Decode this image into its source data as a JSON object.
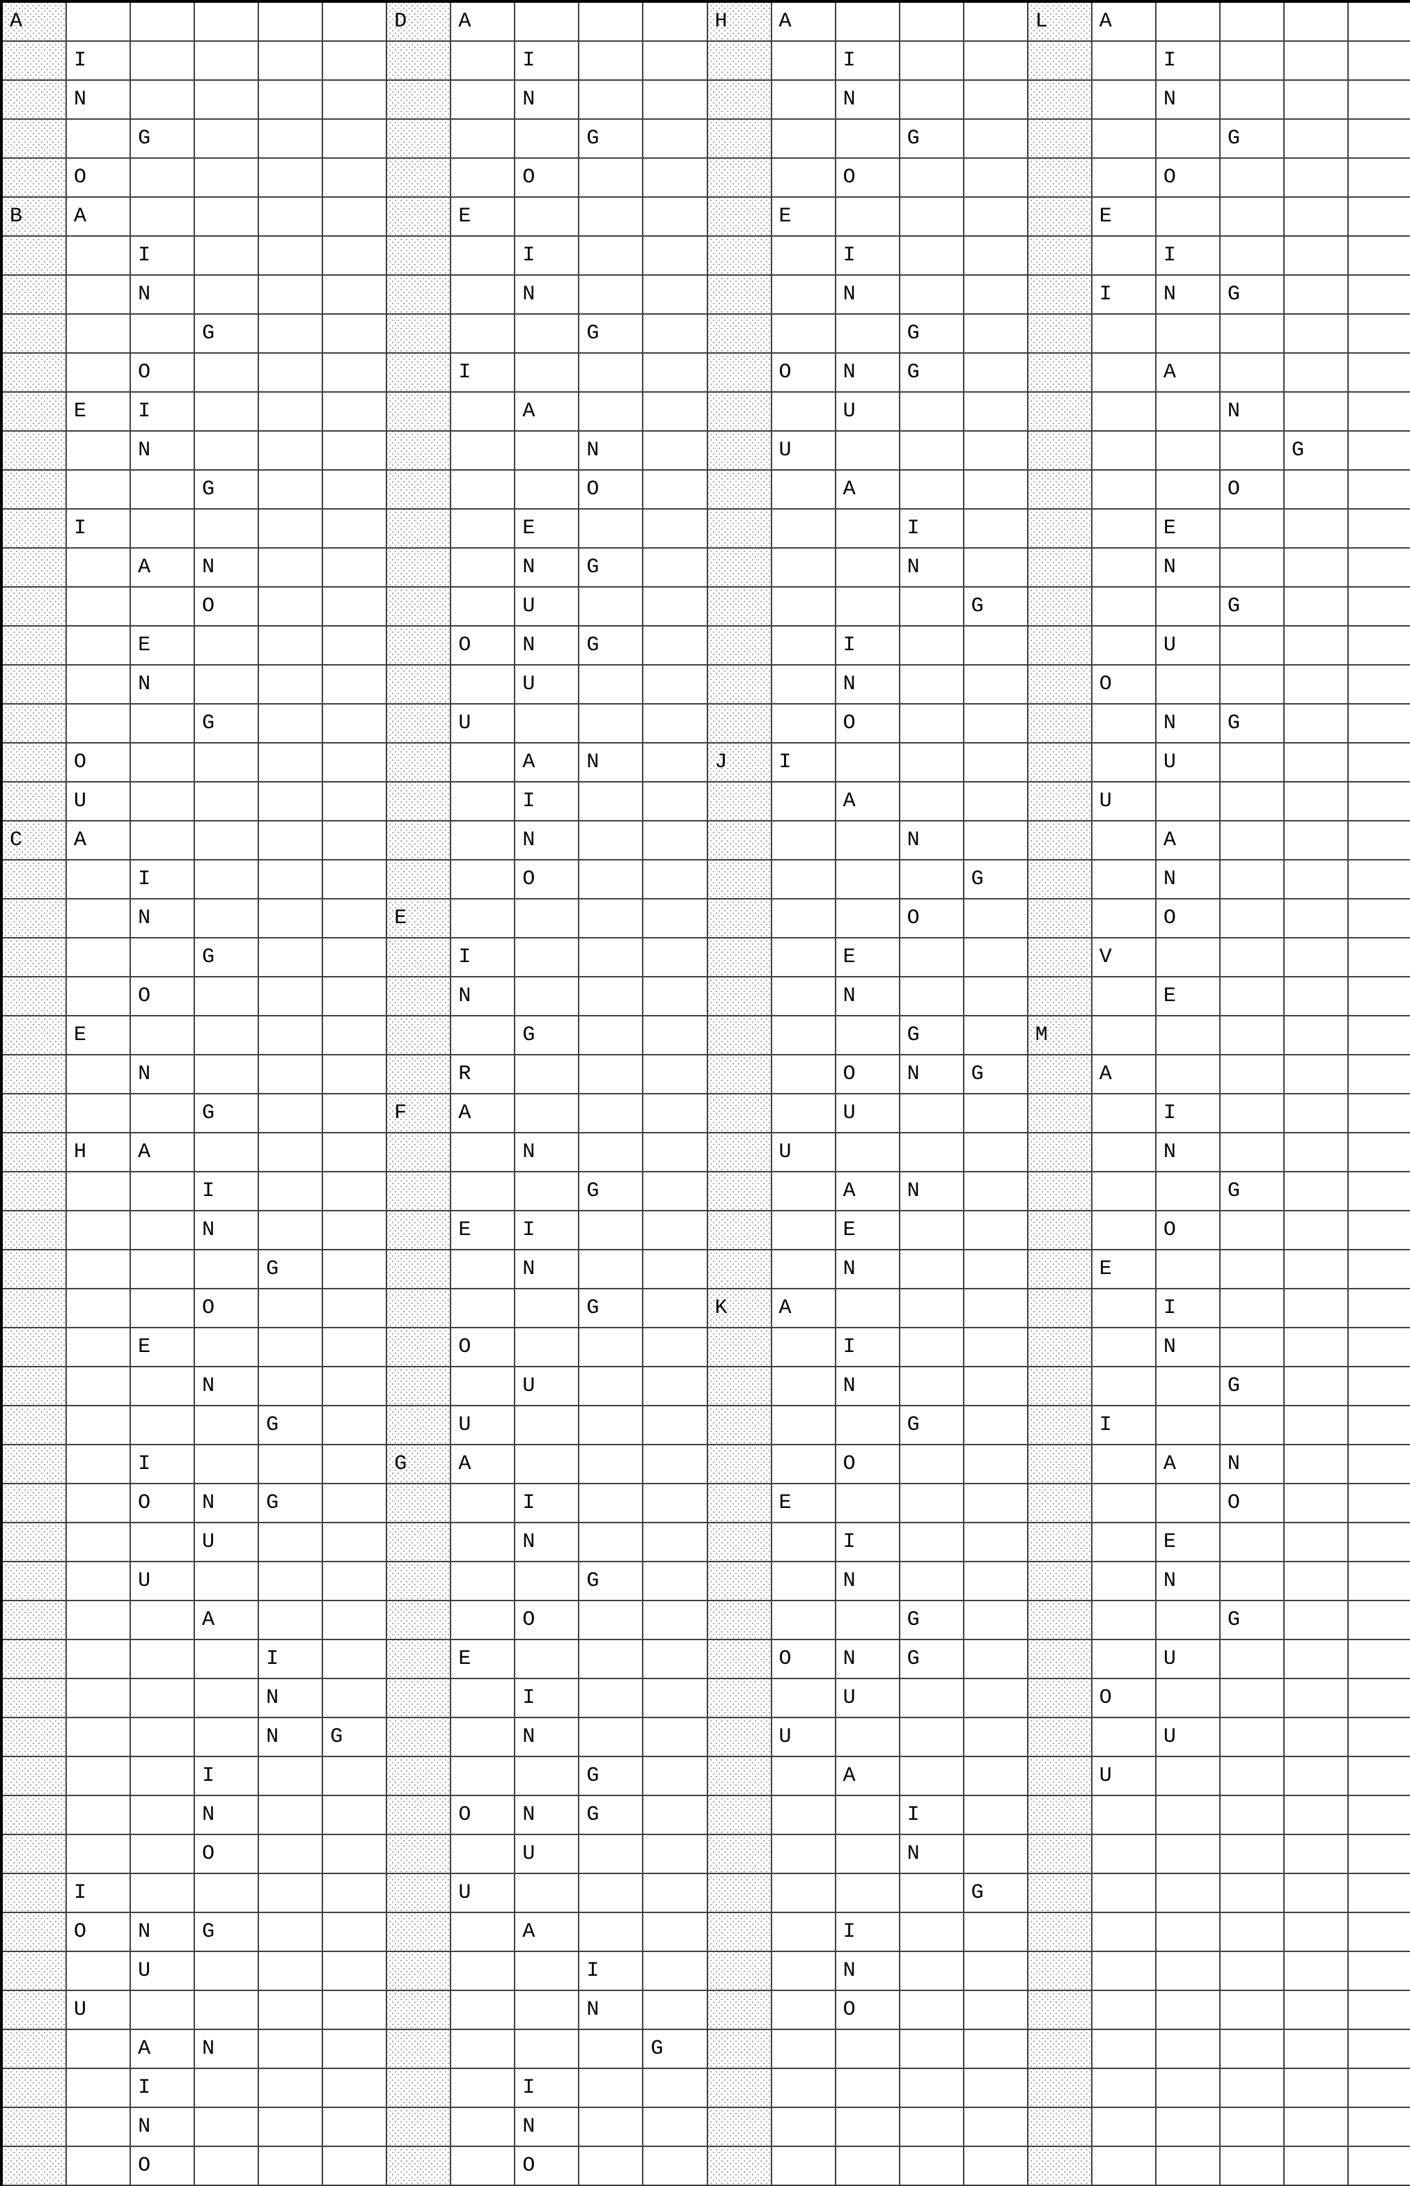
{
  "grid": {
    "cols": 22,
    "rows": 46,
    "cells": [
      {
        "r": 0,
        "c": 0,
        "v": "A"
      },
      {
        "r": 0,
        "c": 6,
        "v": "D"
      },
      {
        "r": 0,
        "c": 7,
        "v": "A"
      },
      {
        "r": 0,
        "c": 11,
        "v": "H"
      },
      {
        "r": 0,
        "c": 12,
        "v": "A"
      },
      {
        "r": 0,
        "c": 16,
        "v": "L"
      },
      {
        "r": 0,
        "c": 17,
        "v": "A"
      },
      {
        "r": 1,
        "c": 1,
        "v": "I"
      },
      {
        "r": 1,
        "c": 8,
        "v": "I"
      },
      {
        "r": 1,
        "c": 13,
        "v": "I"
      },
      {
        "r": 1,
        "c": 18,
        "v": "I"
      },
      {
        "r": 2,
        "c": 1,
        "v": "N"
      },
      {
        "r": 2,
        "c": 8,
        "v": "N"
      },
      {
        "r": 2,
        "c": 13,
        "v": "N"
      },
      {
        "r": 2,
        "c": 18,
        "v": "N"
      },
      {
        "r": 3,
        "c": 2,
        "v": "G"
      },
      {
        "r": 3,
        "c": 9,
        "v": "G"
      },
      {
        "r": 3,
        "c": 14,
        "v": "G"
      },
      {
        "r": 3,
        "c": 19,
        "v": "G"
      },
      {
        "r": 4,
        "c": 1,
        "v": "O"
      },
      {
        "r": 4,
        "c": 8,
        "v": "O"
      },
      {
        "r": 4,
        "c": 13,
        "v": "O"
      },
      {
        "r": 4,
        "c": 18,
        "v": "O"
      },
      {
        "r": 5,
        "c": 0,
        "v": "B"
      },
      {
        "r": 5,
        "c": 1,
        "v": "A"
      },
      {
        "r": 5,
        "c": 7,
        "v": "E"
      },
      {
        "r": 5,
        "c": 12,
        "v": "E"
      },
      {
        "r": 5,
        "c": 17,
        "v": "E"
      },
      {
        "r": 6,
        "c": 2,
        "v": "I"
      },
      {
        "r": 6,
        "c": 8,
        "v": "I"
      },
      {
        "r": 6,
        "c": 13,
        "v": "I"
      },
      {
        "r": 6,
        "c": 18,
        "v": "I"
      },
      {
        "r": 7,
        "c": 2,
        "v": "N"
      },
      {
        "r": 7,
        "c": 8,
        "v": "N"
      },
      {
        "r": 7,
        "c": 13,
        "v": "N"
      },
      {
        "r": 7,
        "c": 17,
        "v": "I"
      },
      {
        "r": 7,
        "c": 18,
        "v": "N"
      },
      {
        "r": 7,
        "c": 19,
        "v": "G"
      },
      {
        "r": 8,
        "c": 3,
        "v": "G"
      },
      {
        "r": 8,
        "c": 9,
        "v": "G"
      },
      {
        "r": 8,
        "c": 14,
        "v": "G"
      },
      {
        "r": 9,
        "c": 2,
        "v": "O"
      },
      {
        "r": 9,
        "c": 7,
        "v": "I"
      },
      {
        "r": 9,
        "c": 12,
        "v": "O"
      },
      {
        "r": 9,
        "c": 13,
        "v": "N"
      },
      {
        "r": 9,
        "c": 14,
        "v": "G"
      },
      {
        "r": 9,
        "c": 18,
        "v": "A"
      },
      {
        "r": 10,
        "c": 1,
        "v": "E"
      },
      {
        "r": 10,
        "c": 2,
        "v": "I"
      },
      {
        "r": 10,
        "c": 8,
        "v": "A"
      },
      {
        "r": 10,
        "c": 13,
        "v": "U"
      },
      {
        "r": 10,
        "c": 19,
        "v": "N"
      },
      {
        "r": 11,
        "c": 2,
        "v": "N"
      },
      {
        "r": 11,
        "c": 9,
        "v": "N"
      },
      {
        "r": 11,
        "c": 12,
        "v": "U"
      },
      {
        "r": 11,
        "c": 20,
        "v": "G"
      },
      {
        "r": 12,
        "c": 3,
        "v": "G"
      },
      {
        "r": 12,
        "c": 9,
        "v": "O"
      },
      {
        "r": 12,
        "c": 13,
        "v": "A"
      },
      {
        "r": 12,
        "c": 19,
        "v": "O"
      },
      {
        "r": 13,
        "c": 1,
        "v": "I"
      },
      {
        "r": 13,
        "c": 8,
        "v": "E"
      },
      {
        "r": 13,
        "c": 14,
        "v": "I"
      },
      {
        "r": 13,
        "c": 18,
        "v": "E"
      },
      {
        "r": 14,
        "c": 2,
        "v": "A"
      },
      {
        "r": 14,
        "c": 3,
        "v": "N"
      },
      {
        "r": 14,
        "c": 8,
        "v": "N"
      },
      {
        "r": 14,
        "c": 9,
        "v": "G"
      },
      {
        "r": 14,
        "c": 14,
        "v": "N"
      },
      {
        "r": 14,
        "c": 18,
        "v": "N"
      },
      {
        "r": 15,
        "c": 3,
        "v": "O"
      },
      {
        "r": 15,
        "c": 8,
        "v": "U"
      },
      {
        "r": 15,
        "c": 15,
        "v": "G"
      },
      {
        "r": 15,
        "c": 19,
        "v": "G"
      },
      {
        "r": 16,
        "c": 2,
        "v": "E"
      },
      {
        "r": 16,
        "c": 7,
        "v": "O"
      },
      {
        "r": 16,
        "c": 8,
        "v": "N"
      },
      {
        "r": 16,
        "c": 9,
        "v": "G"
      },
      {
        "r": 16,
        "c": 13,
        "v": "I"
      },
      {
        "r": 16,
        "c": 18,
        "v": "U"
      },
      {
        "r": 17,
        "c": 2,
        "v": "N"
      },
      {
        "r": 17,
        "c": 8,
        "v": "U"
      },
      {
        "r": 17,
        "c": 13,
        "v": "N"
      },
      {
        "r": 17,
        "c": 17,
        "v": "O"
      },
      {
        "r": 18,
        "c": 3,
        "v": "G"
      },
      {
        "r": 18,
        "c": 7,
        "v": "U"
      },
      {
        "r": 18,
        "c": 13,
        "v": "O"
      },
      {
        "r": 18,
        "c": 18,
        "v": "N"
      },
      {
        "r": 18,
        "c": 19,
        "v": "G"
      },
      {
        "r": 19,
        "c": 1,
        "v": "O"
      },
      {
        "r": 19,
        "c": 8,
        "v": "A"
      },
      {
        "r": 19,
        "c": 9,
        "v": "N"
      },
      {
        "r": 19,
        "c": 11,
        "v": "J"
      },
      {
        "r": 19,
        "c": 12,
        "v": "I"
      },
      {
        "r": 19,
        "c": 18,
        "v": "U"
      },
      {
        "r": 20,
        "c": 1,
        "v": "U"
      },
      {
        "r": 20,
        "c": 8,
        "v": "I"
      },
      {
        "r": 20,
        "c": 13,
        "v": "A"
      },
      {
        "r": 20,
        "c": 17,
        "v": "U"
      },
      {
        "r": 21,
        "c": 0,
        "v": "C"
      },
      {
        "r": 21,
        "c": 1,
        "v": "A"
      },
      {
        "r": 21,
        "c": 8,
        "v": "N"
      },
      {
        "r": 21,
        "c": 14,
        "v": "N"
      },
      {
        "r": 21,
        "c": 18,
        "v": "A"
      },
      {
        "r": 22,
        "c": 2,
        "v": "I"
      },
      {
        "r": 22,
        "c": 8,
        "v": "O"
      },
      {
        "r": 22,
        "c": 15,
        "v": "G"
      },
      {
        "r": 22,
        "c": 18,
        "v": "N"
      },
      {
        "r": 23,
        "c": 2,
        "v": "N"
      },
      {
        "r": 23,
        "c": 6,
        "v": "E"
      },
      {
        "r": 23,
        "c": 14,
        "v": "O"
      },
      {
        "r": 23,
        "c": 18,
        "v": "O"
      },
      {
        "r": 24,
        "c": 3,
        "v": "G"
      },
      {
        "r": 24,
        "c": 7,
        "v": "I"
      },
      {
        "r": 24,
        "c": 13,
        "v": "E"
      },
      {
        "r": 24,
        "c": 17,
        "v": "V"
      },
      {
        "r": 25,
        "c": 2,
        "v": "O"
      },
      {
        "r": 25,
        "c": 7,
        "v": "N"
      },
      {
        "r": 25,
        "c": 13,
        "v": "N"
      },
      {
        "r": 25,
        "c": 18,
        "v": "E"
      },
      {
        "r": 26,
        "c": 1,
        "v": "E"
      },
      {
        "r": 26,
        "c": 8,
        "v": "G"
      },
      {
        "r": 26,
        "c": 14,
        "v": "G"
      },
      {
        "r": 26,
        "c": 16,
        "v": "M"
      },
      {
        "r": 27,
        "c": 2,
        "v": "N"
      },
      {
        "r": 27,
        "c": 7,
        "v": "R"
      },
      {
        "r": 27,
        "c": 13,
        "v": "O"
      },
      {
        "r": 27,
        "c": 14,
        "v": "N"
      },
      {
        "r": 27,
        "c": 15,
        "v": "G"
      },
      {
        "r": 27,
        "c": 17,
        "v": "A"
      },
      {
        "r": 28,
        "c": 3,
        "v": "G"
      },
      {
        "r": 28,
        "c": 6,
        "v": "F"
      },
      {
        "r": 28,
        "c": 7,
        "v": "A"
      },
      {
        "r": 28,
        "c": 13,
        "v": "U"
      },
      {
        "r": 28,
        "c": 18,
        "v": "I"
      },
      {
        "r": 29,
        "c": 1,
        "v": "H"
      },
      {
        "r": 29,
        "c": 2,
        "v": "A"
      },
      {
        "r": 29,
        "c": 8,
        "v": "N"
      },
      {
        "r": 29,
        "c": 12,
        "v": "U"
      },
      {
        "r": 29,
        "c": 18,
        "v": "N"
      },
      {
        "r": 30,
        "c": 3,
        "v": "I"
      },
      {
        "r": 30,
        "c": 9,
        "v": "G"
      },
      {
        "r": 30,
        "c": 13,
        "v": "A"
      },
      {
        "r": 30,
        "c": 14,
        "v": "N"
      },
      {
        "r": 30,
        "c": 19,
        "v": "G"
      },
      {
        "r": 31,
        "c": 3,
        "v": "N"
      },
      {
        "r": 31,
        "c": 7,
        "v": "E"
      },
      {
        "r": 31,
        "c": 8,
        "v": "I"
      },
      {
        "r": 31,
        "c": 13,
        "v": "E"
      },
      {
        "r": 31,
        "c": 18,
        "v": "O"
      },
      {
        "r": 32,
        "c": 4,
        "v": "G"
      },
      {
        "r": 32,
        "c": 8,
        "v": "N"
      },
      {
        "r": 32,
        "c": 13,
        "v": "N"
      },
      {
        "r": 32,
        "c": 17,
        "v": "E"
      },
      {
        "r": 33,
        "c": 3,
        "v": "O"
      },
      {
        "r": 33,
        "c": 9,
        "v": "G"
      },
      {
        "r": 33,
        "c": 11,
        "v": "K"
      },
      {
        "r": 33,
        "c": 12,
        "v": "A"
      },
      {
        "r": 33,
        "c": 18,
        "v": "I"
      },
      {
        "r": 34,
        "c": 2,
        "v": "E"
      },
      {
        "r": 34,
        "c": 7,
        "v": "O"
      },
      {
        "r": 34,
        "c": 13,
        "v": "I"
      },
      {
        "r": 34,
        "c": 18,
        "v": "N"
      },
      {
        "r": 35,
        "c": 3,
        "v": "N"
      },
      {
        "r": 35,
        "c": 8,
        "v": "U"
      },
      {
        "r": 35,
        "c": 13,
        "v": "N"
      },
      {
        "r": 35,
        "c": 19,
        "v": "G"
      },
      {
        "r": 36,
        "c": 4,
        "v": "G"
      },
      {
        "r": 36,
        "c": 7,
        "v": "U"
      },
      {
        "r": 36,
        "c": 14,
        "v": "G"
      },
      {
        "r": 36,
        "c": 17,
        "v": "I"
      },
      {
        "r": 37,
        "c": 2,
        "v": "I"
      },
      {
        "r": 37,
        "c": 6,
        "v": "G"
      },
      {
        "r": 37,
        "c": 7,
        "v": "A"
      },
      {
        "r": 37,
        "c": 13,
        "v": "O"
      },
      {
        "r": 37,
        "c": 18,
        "v": "A"
      },
      {
        "r": 37,
        "c": 19,
        "v": "N"
      },
      {
        "r": 38,
        "c": 2,
        "v": "O"
      },
      {
        "r": 38,
        "c": 3,
        "v": "N"
      },
      {
        "r": 38,
        "c": 4,
        "v": "G"
      },
      {
        "r": 38,
        "c": 8,
        "v": "I"
      },
      {
        "r": 38,
        "c": 12,
        "v": "E"
      },
      {
        "r": 38,
        "c": 19,
        "v": "O"
      },
      {
        "r": 39,
        "c": 3,
        "v": "U"
      },
      {
        "r": 39,
        "c": 8,
        "v": "N"
      },
      {
        "r": 39,
        "c": 13,
        "v": "I"
      },
      {
        "r": 39,
        "c": 18,
        "v": "E"
      },
      {
        "r": 40,
        "c": 2,
        "v": "U"
      },
      {
        "r": 40,
        "c": 9,
        "v": "G"
      },
      {
        "r": 40,
        "c": 13,
        "v": "N"
      },
      {
        "r": 40,
        "c": 18,
        "v": "N"
      },
      {
        "r": 41,
        "c": 3,
        "v": "A"
      },
      {
        "r": 41,
        "c": 8,
        "v": "O"
      },
      {
        "r": 41,
        "c": 14,
        "v": "G"
      },
      {
        "r": 41,
        "c": 19,
        "v": "G"
      },
      {
        "r": 42,
        "c": 4,
        "v": "I"
      },
      {
        "r": 42,
        "c": 7,
        "v": "E"
      },
      {
        "r": 42,
        "c": 12,
        "v": "O"
      },
      {
        "r": 42,
        "c": 13,
        "v": "N"
      },
      {
        "r": 42,
        "c": 14,
        "v": "G"
      },
      {
        "r": 42,
        "c": 18,
        "v": "U"
      },
      {
        "r": 43,
        "c": 4,
        "v": "N"
      },
      {
        "r": 43,
        "c": 8,
        "v": "I"
      },
      {
        "r": 43,
        "c": 13,
        "v": "U"
      },
      {
        "r": 43,
        "c": 17,
        "v": "O"
      },
      {
        "r": 44,
        "c": 4,
        "v": "N"
      },
      {
        "r": 44,
        "c": 5,
        "v": "G"
      },
      {
        "r": 44,
        "c": 8,
        "v": "N"
      },
      {
        "r": 44,
        "c": 12,
        "v": "U"
      },
      {
        "r": 44,
        "c": 18,
        "v": "U"
      },
      {
        "r": 45,
        "c": 3,
        "v": "I"
      },
      {
        "r": 45,
        "c": 9,
        "v": "G"
      },
      {
        "r": 45,
        "c": 13,
        "v": "A"
      },
      {
        "r": 45,
        "c": 17,
        "v": "U"
      }
    ],
    "extra_rows": [
      [
        {
          "c": 3,
          "v": "N"
        },
        {
          "c": 7,
          "v": "O"
        },
        {
          "c": 8,
          "v": "N"
        },
        {
          "c": 9,
          "v": "G"
        },
        {
          "c": 14,
          "v": "I"
        }
      ],
      [
        {
          "c": 3,
          "v": "O"
        },
        {
          "c": 8,
          "v": "U"
        },
        {
          "c": 14,
          "v": "N"
        }
      ],
      [
        {
          "c": 1,
          "v": "I"
        },
        {
          "c": 7,
          "v": "U"
        },
        {
          "c": 15,
          "v": "G"
        }
      ],
      [
        {
          "c": 1,
          "v": "O"
        },
        {
          "c": 2,
          "v": "N"
        },
        {
          "c": 3,
          "v": "G"
        },
        {
          "c": 8,
          "v": "A"
        },
        {
          "c": 13,
          "v": "I"
        }
      ],
      [
        {
          "c": 2,
          "v": "U"
        },
        {
          "c": 9,
          "v": "I"
        },
        {
          "c": 13,
          "v": "N"
        }
      ],
      [
        {
          "c": 1,
          "v": "U"
        },
        {
          "c": 9,
          "v": "N"
        },
        {
          "c": 13,
          "v": "O"
        }
      ],
      [
        {
          "c": 2,
          "v": "A"
        },
        {
          "c": 3,
          "v": "N"
        },
        {
          "c": 10,
          "v": "G"
        }
      ],
      [
        {
          "c": 2,
          "v": "I"
        },
        {
          "c": 8,
          "v": "I"
        }
      ],
      [
        {
          "c": 2,
          "v": "N"
        },
        {
          "c": 8,
          "v": "N"
        }
      ],
      [
        {
          "c": 2,
          "v": "O"
        },
        {
          "c": 8,
          "v": "O"
        }
      ]
    ],
    "shaded_cols": [
      0,
      6,
      11,
      16
    ]
  }
}
